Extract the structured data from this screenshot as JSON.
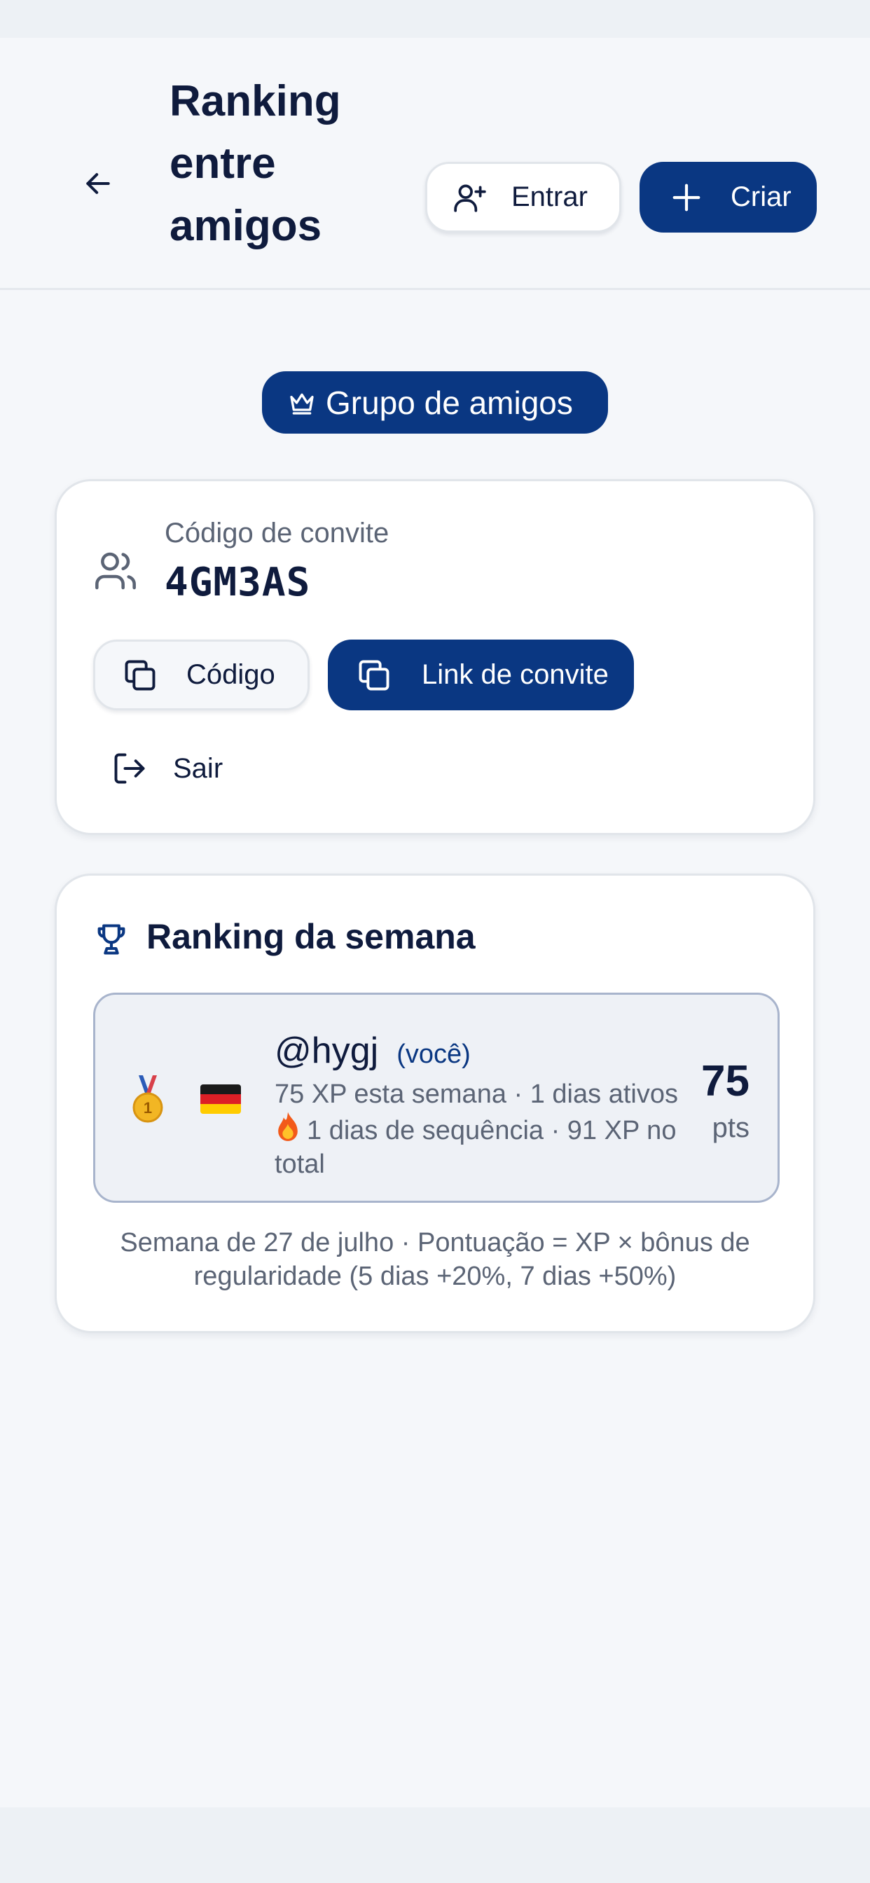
{
  "header": {
    "title": "Ranking entre amigos",
    "join_label": "Entrar",
    "create_label": "Criar"
  },
  "group": {
    "badge_label": "Grupo de amigos"
  },
  "invite": {
    "label": "Código de convite",
    "code": "4GM3AS",
    "copy_code_label": "Código",
    "copy_link_label": "Link de convite",
    "leave_label": "Sair"
  },
  "ranking": {
    "title": "Ranking da semana",
    "entries": [
      {
        "medal": "gold-medal",
        "rank": "1",
        "flag": "germany",
        "username": "@hygj",
        "you_tag": "(você)",
        "stats_line1": "75 XP esta semana · 1 dias ativos",
        "stats_line2": "1 dias de sequência · 91 XP no total",
        "score": "75",
        "score_unit": "pts"
      }
    ],
    "footer": "Semana de 27 de julho · Pontuação = XP × bônus de regularidade (5 dias +20%, 7 dias +50%)"
  },
  "colors": {
    "primary": "#0a3782",
    "text": "#0f1b3d",
    "muted": "#5b6475",
    "background": "#f5f7fa",
    "highlight_row": "#eef1f6",
    "highlight_border": "#a8b4cc"
  },
  "icons": {
    "back": "arrow-left-icon",
    "join": "user-plus-icon",
    "create": "plus-icon",
    "group": "crown-icon",
    "members": "users-icon",
    "copy": "copy-icon",
    "leave": "log-out-icon",
    "ranking": "trophy-icon",
    "streak": "fire-icon"
  }
}
